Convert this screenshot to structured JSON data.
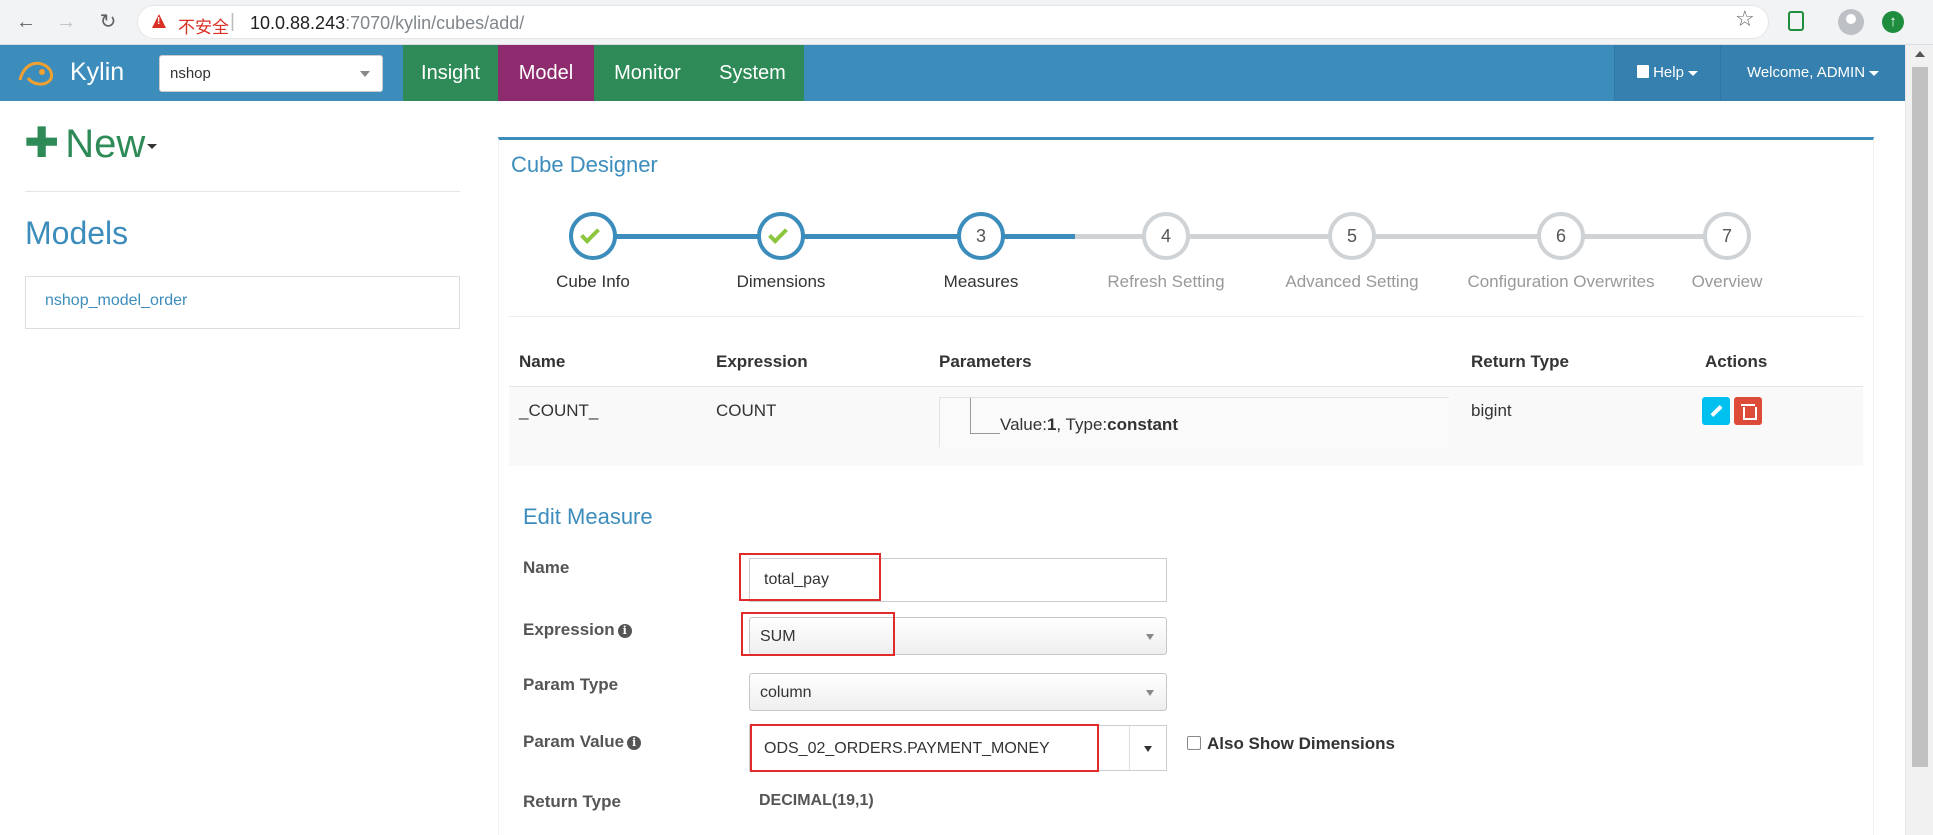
{
  "browser": {
    "insecure_label": "不安全",
    "url_host": "10.0.88.243",
    "url_rest": ":7070/kylin/cubes/add/"
  },
  "app": {
    "logo_text": "Kylin",
    "project": "nshop",
    "nav_tabs": [
      "Insight",
      "Model",
      "Monitor",
      "System"
    ],
    "active_tab": "Model",
    "help_label": "Help",
    "welcome_label": "Welcome, ADMIN"
  },
  "sidebar": {
    "new_label": "New",
    "models_title": "Models",
    "models": [
      "nshop_model_order"
    ]
  },
  "designer": {
    "title": "Cube Designer",
    "steps": [
      {
        "num": "1",
        "label": "Cube Info",
        "state": "done"
      },
      {
        "num": "2",
        "label": "Dimensions",
        "state": "done"
      },
      {
        "num": "3",
        "label": "Measures",
        "state": "current"
      },
      {
        "num": "4",
        "label": "Refresh Setting",
        "state": "future"
      },
      {
        "num": "5",
        "label": "Advanced Setting",
        "state": "future"
      },
      {
        "num": "6",
        "label": "Configuration Overwrites",
        "state": "future"
      },
      {
        "num": "7",
        "label": "Overview",
        "state": "future"
      }
    ]
  },
  "measures_table": {
    "headers": {
      "name": "Name",
      "expression": "Expression",
      "parameters": "Parameters",
      "return_type": "Return Type",
      "actions": "Actions"
    },
    "rows": [
      {
        "name": "_COUNT_",
        "expression": "COUNT",
        "param_value_label": "Value:",
        "param_value": "1",
        "param_type_label": ", Type:",
        "param_type": "constant",
        "return_type": "bigint"
      }
    ]
  },
  "edit_measure": {
    "title": "Edit Measure",
    "name_label": "Name",
    "name_value": "total_pay",
    "expression_label": "Expression",
    "expression_value": "SUM",
    "param_type_label": "Param Type",
    "param_type_value": "column",
    "param_value_label": "Param Value",
    "param_value_value": "ODS_02_ORDERS.PAYMENT_MONEY",
    "also_show_dimensions": "Also Show Dimensions",
    "return_type_label": "Return Type",
    "return_type_value": "DECIMAL(19,1)"
  },
  "colors": {
    "nav_blue": "#3c8dbc",
    "tab_green": "#2e8b57",
    "tab_active": "#8e2a6e",
    "highlight_red": "#e12b2b"
  }
}
